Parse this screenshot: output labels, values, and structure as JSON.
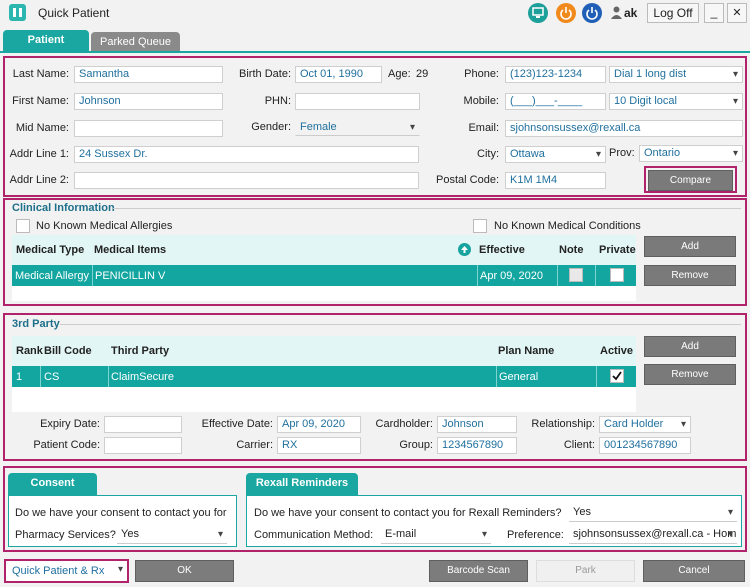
{
  "window": {
    "title": "Quick Patient",
    "user": "ak",
    "logoff": "Log Off",
    "minimize": "_",
    "close": "✕"
  },
  "tabs": {
    "patient": "Patient",
    "parked": "Parked Queue"
  },
  "patient": {
    "last_name_label": "Last Name:",
    "last_name": "Samantha",
    "first_name_label": "First Name:",
    "first_name": "Johnson",
    "mid_name_label": "Mid Name:",
    "mid_name": "",
    "addr1_label": "Addr Line 1:",
    "addr1": "24 Sussex Dr.",
    "addr2_label": "Addr Line 2:",
    "addr2": "",
    "birth_label": "Birth Date:",
    "birth": "Oct 01, 1990",
    "age_label": "Age:",
    "age": "29",
    "phn_label": "PHN:",
    "phn": "",
    "gender_label": "Gender:",
    "gender": "Female",
    "phone_label": "Phone:",
    "phone": "(123)123-1234",
    "phone_type": "Dial 1 long dist",
    "mobile_label": "Mobile:",
    "mobile": "(___)___-____",
    "mobile_type": "10 Digit local",
    "email_label": "Email:",
    "email": "sjohnsonsussex@rexall.ca",
    "city_label": "City:",
    "city": "Ottawa",
    "prov_label": "Prov:",
    "prov": "Ontario",
    "postal_label": "Postal Code:",
    "postal": "K1M 1M4",
    "compare": "Compare"
  },
  "clinical": {
    "title": "Clinical Information",
    "nkma": "No Known Medical Allergies",
    "nkmc": "No Known Medical Conditions",
    "headers": {
      "type": "Medical Type",
      "items": "Medical Items",
      "effective": "Effective",
      "note": "Note",
      "private": "Private"
    },
    "row": {
      "type": "Medical Allergy",
      "items": "PENICILLIN V",
      "effective": "Apr 09, 2020"
    },
    "add": "Add",
    "remove": "Remove"
  },
  "third_party": {
    "title": "3rd Party",
    "headers": {
      "rank": "Rank",
      "bill": "Bill Code",
      "party": "Third Party",
      "plan": "Plan Name",
      "active": "Active"
    },
    "row": {
      "rank": "1",
      "bill": "CS",
      "party": "ClaimSecure",
      "plan": "General"
    },
    "add": "Add",
    "remove": "Remove",
    "expiry_label": "Expiry Date:",
    "expiry": "",
    "effective_label": "Effective Date:",
    "effective": "Apr 09, 2020",
    "cardholder_label": "Cardholder:",
    "cardholder": "Johnson",
    "relationship_label": "Relationship:",
    "relationship": "Card Holder",
    "patient_code_label": "Patient Code:",
    "patient_code": "",
    "carrier_label": "Carrier:",
    "carrier": "RX",
    "group_label": "Group:",
    "group": "1234567890",
    "client_label": "Client:",
    "client": "001234567890"
  },
  "consent": {
    "tab": "Consent",
    "question1": "Do we have your consent to contact you for",
    "pharmacy_label": "Pharmacy Services?",
    "pharmacy_value": "Yes"
  },
  "reminders": {
    "tab": "Rexall Reminders",
    "question": "Do we have your consent to contact you for Rexall Reminders?",
    "answer": "Yes",
    "method_label": "Communication Method:",
    "method": "E-mail",
    "pref_label": "Preference:",
    "pref": "sjohnsonsussex@rexall.ca - Hom"
  },
  "footer": {
    "mode": "Quick Patient & Rx",
    "ok": "OK",
    "barcode": "Barcode Scan",
    "park": "Park",
    "cancel": "Cancel"
  }
}
